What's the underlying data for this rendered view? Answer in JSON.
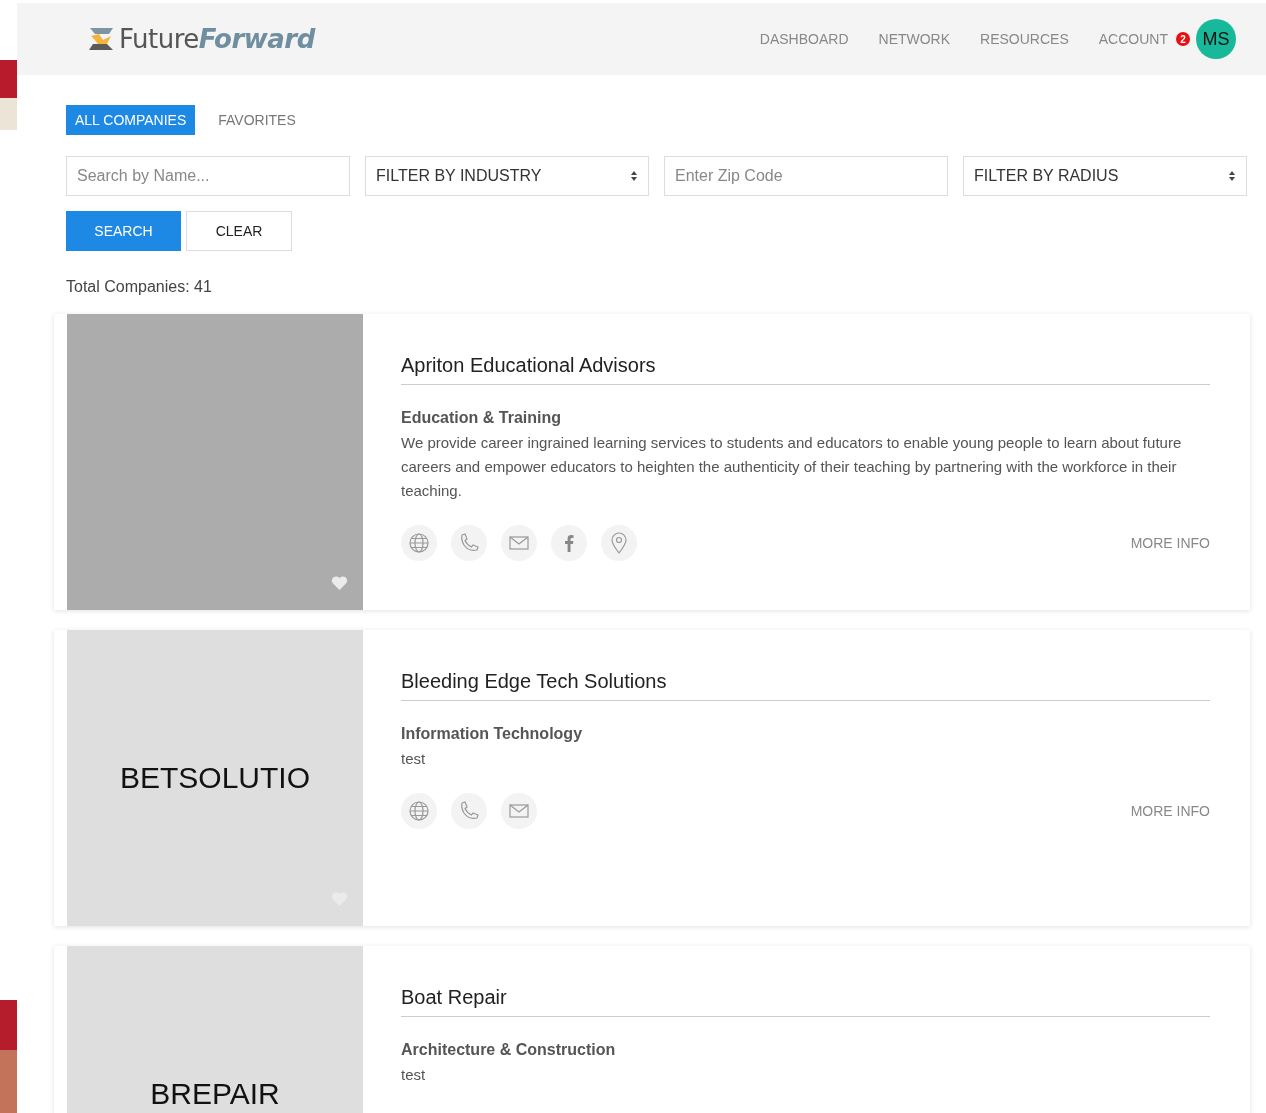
{
  "header": {
    "logo_text": "Future**Forward**",
    "nav": [
      {
        "label": "DASHBOARD"
      },
      {
        "label": "NETWORK"
      },
      {
        "label": "RESOURCES"
      },
      {
        "label": "ACCOUNT",
        "badge": "2"
      }
    ],
    "avatar": "MS"
  },
  "tabs": [
    {
      "label": "ALL COMPANIES",
      "selected": true
    },
    {
      "label": "FAVORITES",
      "selected": false
    }
  ],
  "filters": [
    {
      "kind": "input",
      "placeholder": "Search by Name..."
    },
    {
      "kind": "select",
      "label": "FILTER BY INDUSTRY"
    },
    {
      "kind": "input",
      "placeholder": "Enter Zip Code"
    },
    {
      "kind": "select",
      "label": "FILTER BY RADIUS"
    }
  ],
  "buttons": [
    {
      "label": "SEARCH",
      "kind": "primary"
    },
    {
      "label": "CLEAR",
      "kind": "secondary"
    }
  ],
  "total": "Total Companies: 41",
  "companies": [
    {
      "name": "Apriton Educational Advisors",
      "industry": "Education & Training",
      "description": "We provide career ingrained learning services to students and educators to enable young people to learn about future careers and empower educators to heighten the authenticity of their teaching by partnering with the workforce in their teaching.",
      "image": {
        "kind": "blank"
      },
      "favorite": false,
      "contacts": [
        {
          "kind": "web"
        },
        {
          "kind": "phone"
        },
        {
          "kind": "email"
        },
        {
          "kind": "facebook"
        },
        {
          "kind": "location"
        }
      ],
      "more": "MORE INFO"
    },
    {
      "name": "Bleeding Edge Tech Solutions",
      "industry": "Information Technology",
      "description": "test",
      "image": {
        "kind": "text",
        "text": "BETSOLUTIO"
      },
      "favorite": false,
      "contacts": [
        {
          "kind": "web"
        },
        {
          "kind": "phone"
        },
        {
          "kind": "email"
        }
      ],
      "more": "MORE INFO"
    },
    {
      "name": "Boat Repair",
      "industry": "Architecture & Construction",
      "description": "test",
      "image": {
        "kind": "text",
        "text": "BREPAIR"
      }
    }
  ]
}
